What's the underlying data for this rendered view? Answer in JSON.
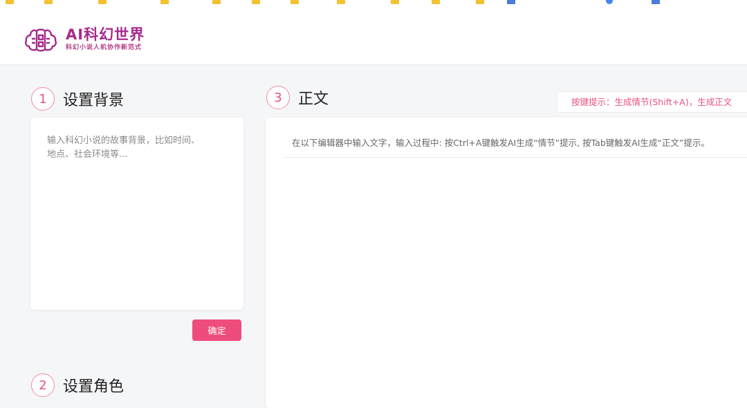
{
  "header": {
    "logo_title": "AI科幻世界",
    "logo_subtitle": "科幻小说人机协作新范式"
  },
  "sections": {
    "background": {
      "number": "1",
      "title": "设置背景"
    },
    "roles": {
      "number": "2",
      "title": "设置角色"
    },
    "text": {
      "number": "3",
      "title": "正文"
    }
  },
  "background_input": {
    "placeholder": "输入科幻小说的故事背景，比如时间、地点、社会环境等..."
  },
  "confirm_button": {
    "label": "确定"
  },
  "hint": {
    "text": "按键提示：生成情节(Shift+A)，生成正文"
  },
  "editor": {
    "placeholder": "在以下编辑器中输入文字，输入过程中: 按Ctrl+A键触发AI生成“情节”提示, 按Tab键触发AI生成“正文”提示。"
  },
  "colors": {
    "accent": "#ee4d7c",
    "logo": "#a52a8d"
  }
}
